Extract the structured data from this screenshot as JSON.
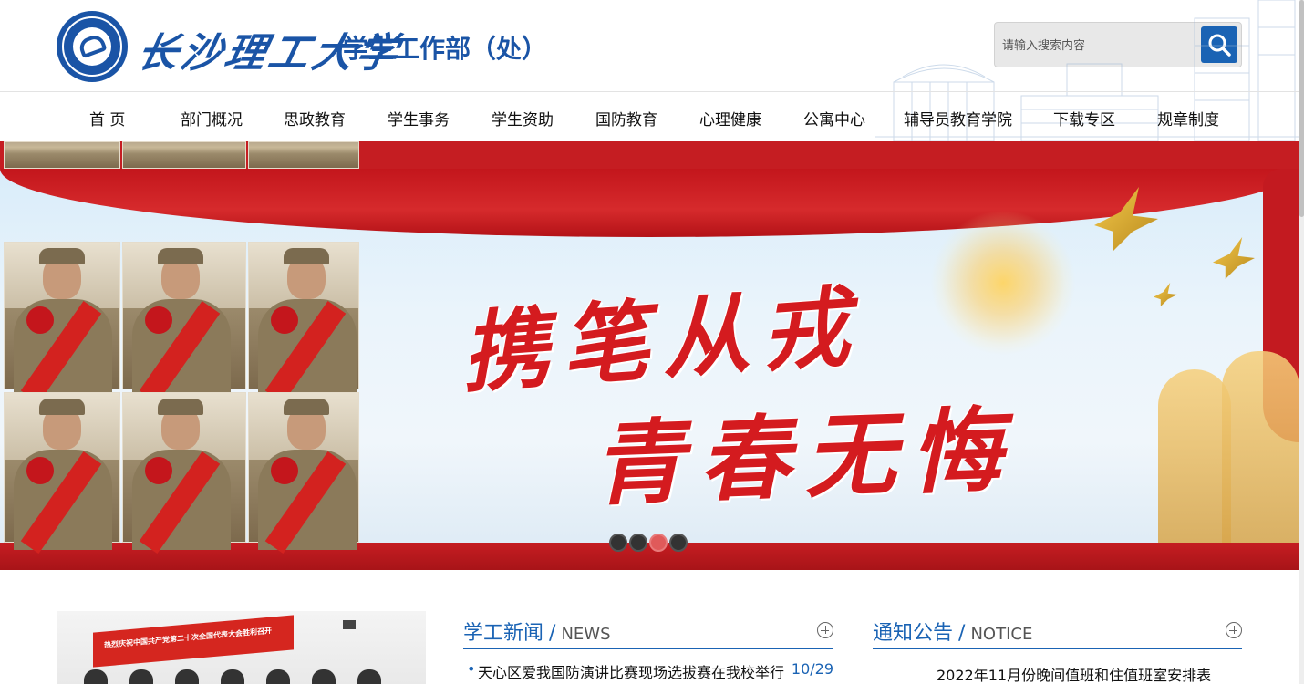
{
  "header": {
    "school_name": "长沙理工大学",
    "dept_name": "学生工作部（处）",
    "search_placeholder": "请输入搜索内容"
  },
  "nav": {
    "items": [
      "首 页",
      "部门概况",
      "思政教育",
      "学生事务",
      "学生资助",
      "国防教育",
      "心理健康",
      "公寓中心",
      "辅导员教育学院",
      "下载专区",
      "规章制度"
    ]
  },
  "banner": {
    "line1": "携笔从戎",
    "line2": "青春无悔",
    "slides": 4,
    "active_slide": 3
  },
  "news": {
    "title": "学工新闻",
    "title_en": "NEWS",
    "items": [
      {
        "text": "天心区爱我国防演讲比赛现场选拔赛在我校举行",
        "date": "10/29"
      }
    ],
    "image_caption": "热烈庆祝中国共产党第二十次全国代表大会胜利召开"
  },
  "notice": {
    "title": "通知公告",
    "title_en": "NOTICE",
    "items": [
      {
        "text": "2022年11月份晚间值班和住值班室安排表"
      }
    ]
  },
  "colors": {
    "primary": "#1a63b4",
    "logo": "#1a54a6",
    "banner_red": "#c51d22"
  }
}
